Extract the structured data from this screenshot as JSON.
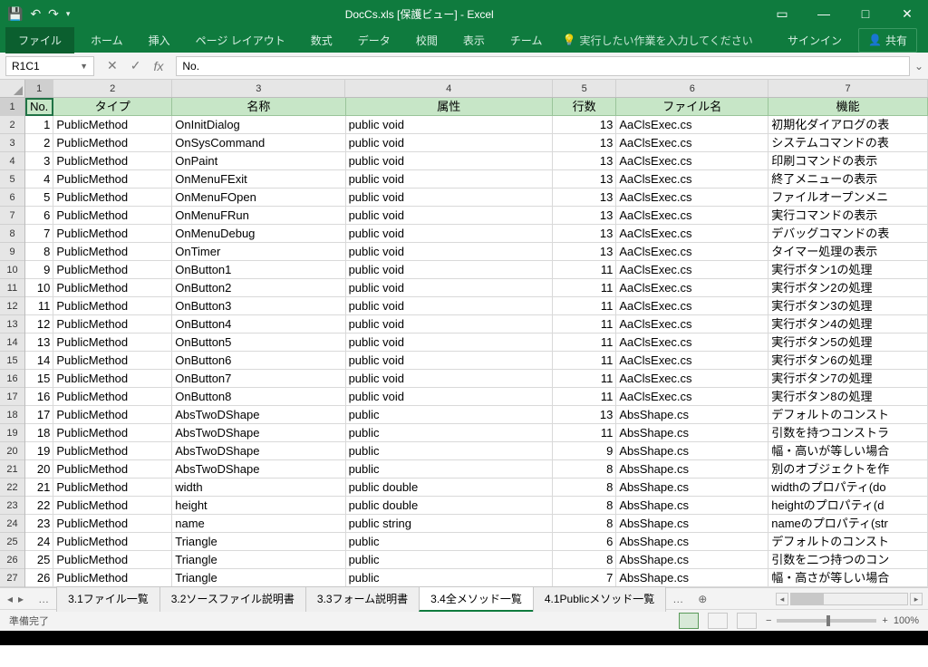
{
  "title": "DocCs.xls [保護ビュー] - Excel",
  "qat": {
    "save": "💾",
    "undo": "↶",
    "redo": "↷"
  },
  "win": {
    "ribopt": "▭",
    "min": "—",
    "max": "□",
    "close": "✕"
  },
  "ribbon": {
    "file": "ファイル",
    "tabs": [
      "ホーム",
      "挿入",
      "ページ レイアウト",
      "数式",
      "データ",
      "校閲",
      "表示",
      "チーム"
    ],
    "tell_icon": "💡",
    "tell": "実行したい作業を入力してください",
    "signin": "サインイン",
    "share_icon": "👤",
    "share": "共有"
  },
  "namebox": "R1C1",
  "fx": {
    "cancel": "✕",
    "enter": "✓",
    "label": "fx",
    "value": "No."
  },
  "cols": [
    {
      "n": "1",
      "w": "c1"
    },
    {
      "n": "2",
      "w": "c2"
    },
    {
      "n": "3",
      "w": "c3"
    },
    {
      "n": "4",
      "w": "c4"
    },
    {
      "n": "5",
      "w": "c5"
    },
    {
      "n": "6",
      "w": "c6"
    },
    {
      "n": "7",
      "w": "c7"
    }
  ],
  "headers": [
    "No.",
    "タイプ",
    "名称",
    "属性",
    "行数",
    "ファイル名",
    "機能"
  ],
  "rows": [
    [
      1,
      "PublicMethod",
      "OnInitDialog",
      "public void",
      13,
      "AaClsExec.cs",
      "初期化ダイアログの表"
    ],
    [
      2,
      "PublicMethod",
      "OnSysCommand",
      "public void",
      13,
      "AaClsExec.cs",
      "システムコマンドの表"
    ],
    [
      3,
      "PublicMethod",
      "OnPaint",
      "public void",
      13,
      "AaClsExec.cs",
      "印刷コマンドの表示"
    ],
    [
      4,
      "PublicMethod",
      "OnMenuFExit",
      "public void",
      13,
      "AaClsExec.cs",
      "終了メニューの表示"
    ],
    [
      5,
      "PublicMethod",
      "OnMenuFOpen",
      "public void",
      13,
      "AaClsExec.cs",
      "ファイルオープンメニ"
    ],
    [
      6,
      "PublicMethod",
      "OnMenuFRun",
      "public void",
      13,
      "AaClsExec.cs",
      "実行コマンドの表示"
    ],
    [
      7,
      "PublicMethod",
      "OnMenuDebug",
      "public void",
      13,
      "AaClsExec.cs",
      "デバッグコマンドの表"
    ],
    [
      8,
      "PublicMethod",
      "OnTimer",
      "public void",
      13,
      "AaClsExec.cs",
      "タイマー処理の表示"
    ],
    [
      9,
      "PublicMethod",
      "OnButton1",
      "public void",
      11,
      "AaClsExec.cs",
      "実行ボタン1の処理"
    ],
    [
      10,
      "PublicMethod",
      "OnButton2",
      "public void",
      11,
      "AaClsExec.cs",
      "実行ボタン2の処理"
    ],
    [
      11,
      "PublicMethod",
      "OnButton3",
      "public void",
      11,
      "AaClsExec.cs",
      "実行ボタン3の処理"
    ],
    [
      12,
      "PublicMethod",
      "OnButton4",
      "public void",
      11,
      "AaClsExec.cs",
      "実行ボタン4の処理"
    ],
    [
      13,
      "PublicMethod",
      "OnButton5",
      "public void",
      11,
      "AaClsExec.cs",
      "実行ボタン5の処理"
    ],
    [
      14,
      "PublicMethod",
      "OnButton6",
      "public void",
      11,
      "AaClsExec.cs",
      "実行ボタン6の処理"
    ],
    [
      15,
      "PublicMethod",
      "OnButton7",
      "public void",
      11,
      "AaClsExec.cs",
      "実行ボタン7の処理"
    ],
    [
      16,
      "PublicMethod",
      "OnButton8",
      "public void",
      11,
      "AaClsExec.cs",
      "実行ボタン8の処理"
    ],
    [
      17,
      "PublicMethod",
      "AbsTwoDShape",
      "public",
      13,
      "AbsShape.cs",
      "デフォルトのコンスト"
    ],
    [
      18,
      "PublicMethod",
      "AbsTwoDShape",
      "public",
      11,
      "AbsShape.cs",
      "引数を持つコンストラ"
    ],
    [
      19,
      "PublicMethod",
      "AbsTwoDShape",
      "public",
      9,
      "AbsShape.cs",
      "幅・高いが等しい場合"
    ],
    [
      20,
      "PublicMethod",
      "AbsTwoDShape",
      "public",
      8,
      "AbsShape.cs",
      "別のオブジェクトを作"
    ],
    [
      21,
      "PublicMethod",
      "width",
      "public double",
      8,
      "AbsShape.cs",
      "widthのプロパティ(do"
    ],
    [
      22,
      "PublicMethod",
      "height",
      "public double",
      8,
      "AbsShape.cs",
      "heightのプロパティ(d"
    ],
    [
      23,
      "PublicMethod",
      "name",
      "public string",
      8,
      "AbsShape.cs",
      "nameのプロパティ(str"
    ],
    [
      24,
      "PublicMethod",
      "Triangle",
      "public",
      6,
      "AbsShape.cs",
      "デフォルトのコンスト"
    ],
    [
      25,
      "PublicMethod",
      "Triangle",
      "public",
      8,
      "AbsShape.cs",
      "引数を二つ持つのコン"
    ],
    [
      26,
      "PublicMethod",
      "Triangle",
      "public",
      7,
      "AbsShape.cs",
      "幅・高さが等しい場合"
    ]
  ],
  "sheettabs": {
    "ellipsis": "…",
    "items": [
      "3.1ファイル一覧",
      "3.2ソースファイル説明書",
      "3.3フォーム説明書",
      "3.4全メソッド一覧",
      "4.1Publicメソッド一覧"
    ],
    "active": 3,
    "new": "⊕"
  },
  "status": {
    "ready": "準備完了",
    "zoom": "100%",
    "minus": "−",
    "plus": "+"
  }
}
